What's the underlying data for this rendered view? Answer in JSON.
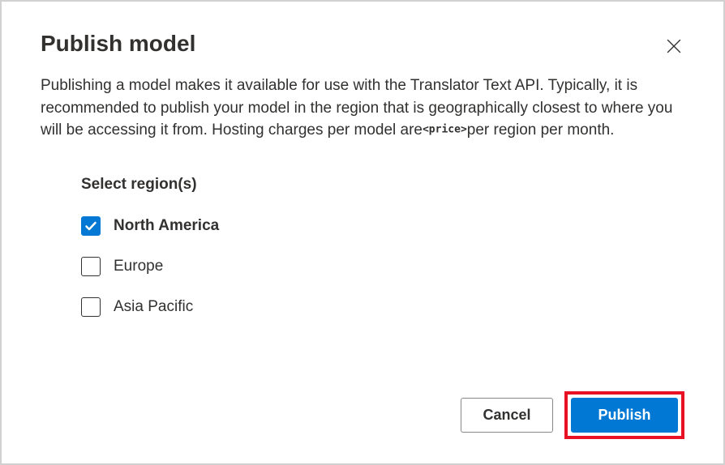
{
  "dialog": {
    "title": "Publish model",
    "description_parts": {
      "p1": "Publishing a model makes it available for use with the Translator Text API. Typically, it is recommended to publish your model in the region that is geographically closest to where you will be accessing it from. Hosting charges per model are",
      "price_placeholder": "<price>",
      "p2": "per region per month."
    }
  },
  "regions": {
    "heading": "Select region(s)",
    "options": [
      {
        "label": "North America",
        "checked": true
      },
      {
        "label": "Europe",
        "checked": false
      },
      {
        "label": "Asia Pacific",
        "checked": false
      }
    ]
  },
  "footer": {
    "cancel": "Cancel",
    "publish": "Publish"
  }
}
